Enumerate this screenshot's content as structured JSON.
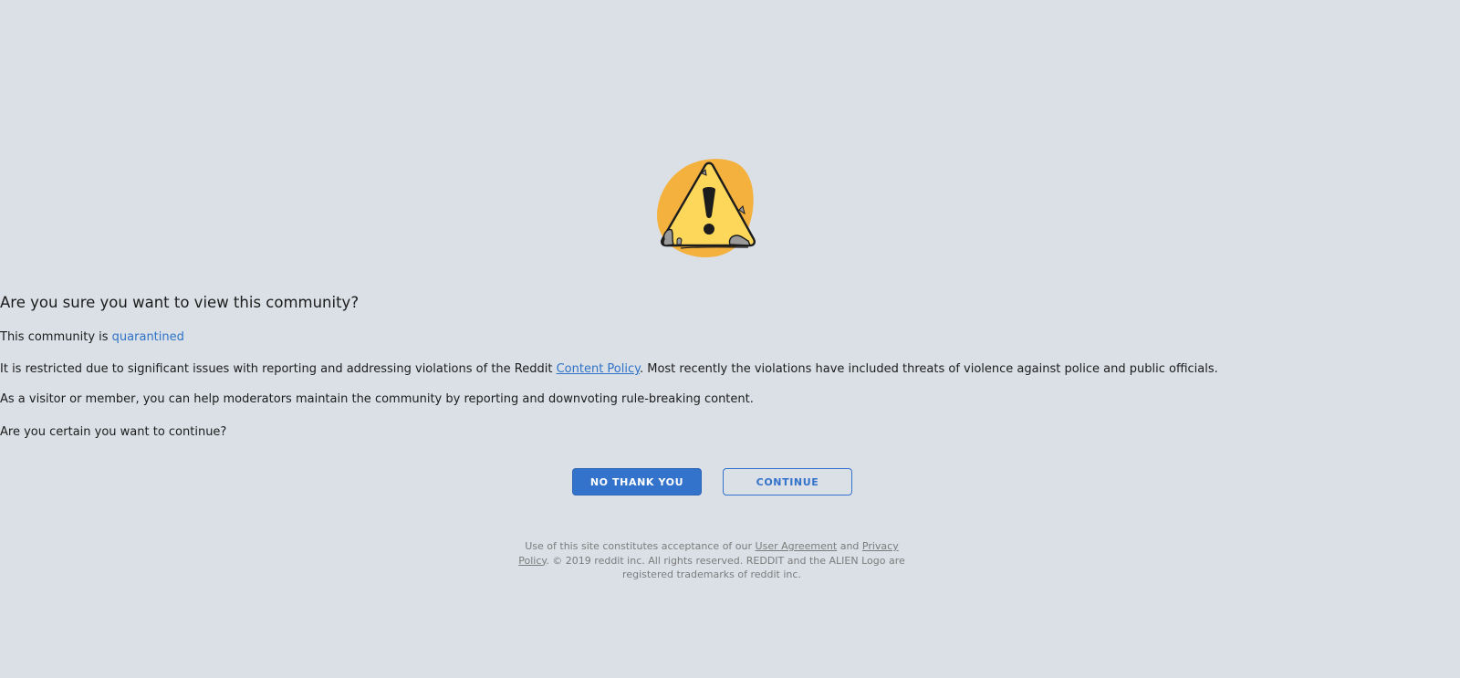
{
  "dialog": {
    "heading": "Are you sure you want to view this community?",
    "status_prefix": "This community is",
    "status_link": "quarantined",
    "desc1_before": "It is restricted due to significant issues with reporting and addressing violations of the Reddit",
    "desc1_link": "Content Policy",
    "desc1_after": ". Most recently the violations have included threats of violence against police and public officials.",
    "desc2": "As a visitor or member, you can help moderators maintain the community by reporting and downvoting rule-breaking content.",
    "question": "Are you certain you want to continue?",
    "decline_label": "NO THANK YOU",
    "continue_label": "CONTINUE",
    "icon": "warning-triangle-icon"
  },
  "footer": {
    "text_before": "Use of this site constitutes acceptance of our",
    "user_agreement": "User Agreement",
    "and": "and",
    "privacy_policy": "Privacy Policy",
    "text_after": ". © 2019 reddit inc. All rights reserved. REDDIT and the ALIEN Logo are registered trademarks of reddit inc."
  },
  "colors": {
    "background": "#dae0e6",
    "accent": "#3373cb",
    "warning_blob": "#f4b13d",
    "warning_triangle": "#fcd75a"
  }
}
